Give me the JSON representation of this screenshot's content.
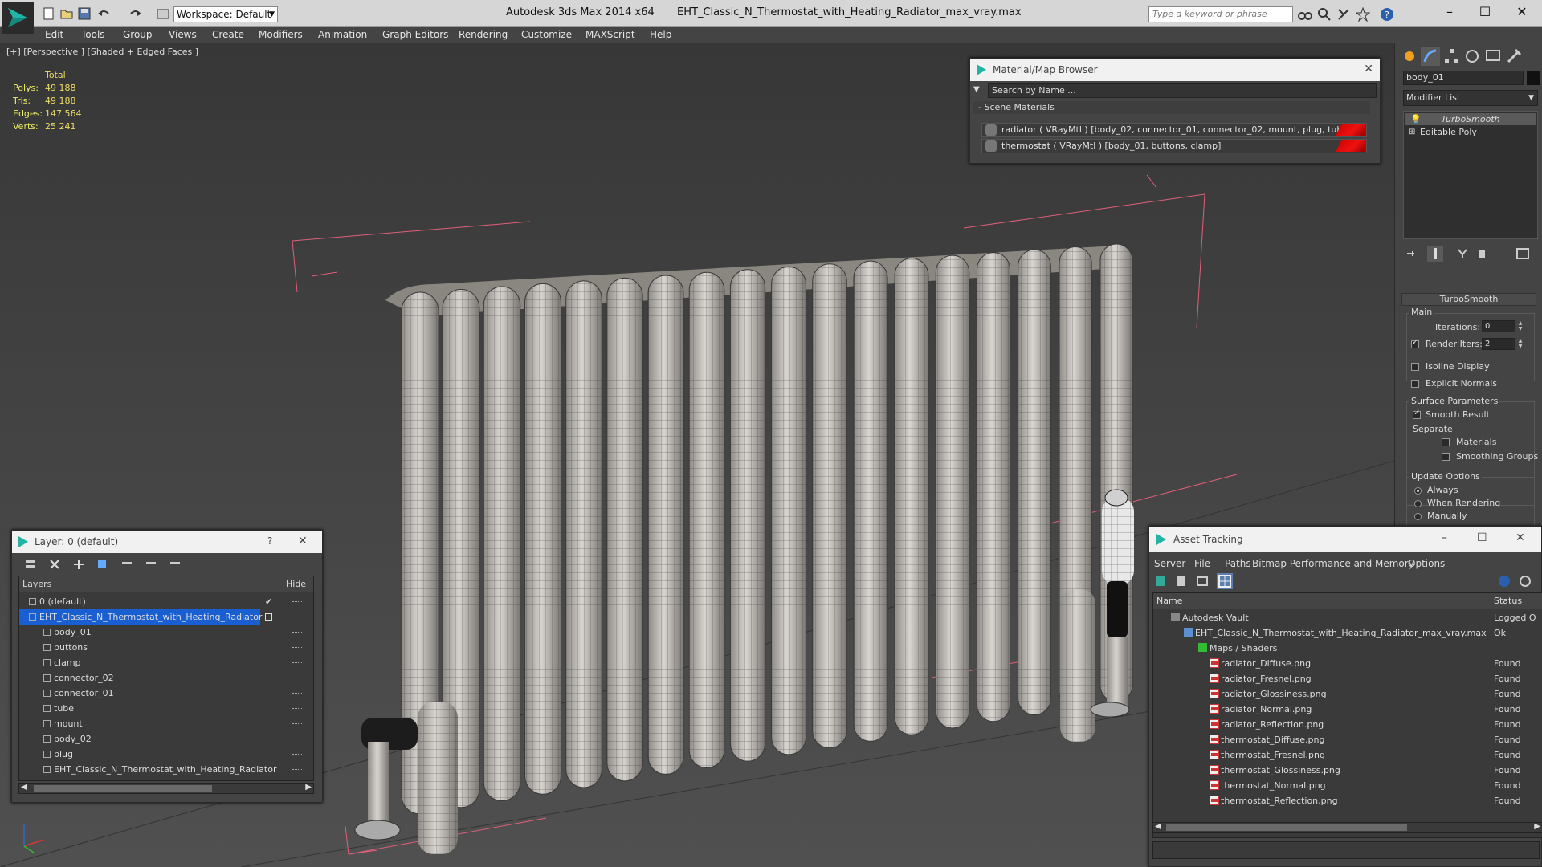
{
  "title_bar": {
    "app_title": "Autodesk 3ds Max  2014 x64",
    "file_name": "EHT_Classic_N_Thermostat_with_Heating_Radiator_max_vray.max",
    "workspace_label": "Workspace: Default",
    "search_placeholder": "Type a keyword or phrase"
  },
  "menu": [
    "Edit",
    "Tools",
    "Group",
    "Views",
    "Create",
    "Modifiers",
    "Animation",
    "Graph Editors",
    "Rendering",
    "Customize",
    "MAXScript",
    "Help"
  ],
  "viewport": {
    "label": "[+] [Perspective ] [Shaded + Edged Faces ]",
    "stats": {
      "header": "Total",
      "rows": [
        {
          "label": "Polys:",
          "value": "49 188"
        },
        {
          "label": "Tris:",
          "value": "49 188"
        },
        {
          "label": "Edges:",
          "value": "147 564"
        },
        {
          "label": "Verts:",
          "value": "25 241"
        }
      ]
    }
  },
  "material_browser": {
    "title": "Material/Map Browser",
    "search_placeholder": "Search by Name ...",
    "section": "- Scene Materials",
    "materials": [
      "radiator  ( VRayMtl ) [body_02, connector_01, connector_02, mount, plug, tube]",
      "thermostat  ( VRayMtl ) [body_01, buttons, clamp]"
    ]
  },
  "command_panel": {
    "object_name": "body_01",
    "modifier_list": "Modifier List",
    "stack": [
      "TurboSmooth",
      "Editable Poly"
    ],
    "rollout_title": "TurboSmooth",
    "main_label": "Main",
    "iterations_label": "Iterations:",
    "iterations_value": "0",
    "render_iters_label": "Render Iters:",
    "render_iters_value": "2",
    "isoline_label": "Isoline Display",
    "explicit_normals_label": "Explicit Normals",
    "surface_params_label": "Surface Parameters",
    "smooth_result_label": "Smooth Result",
    "separate_label": "Separate",
    "materials_label": "Materials",
    "smoothing_groups_label": "Smoothing Groups",
    "update_options_label": "Update Options",
    "always_label": "Always",
    "when_rendering_label": "When Rendering",
    "manually_label": "Manually"
  },
  "layer_panel": {
    "title": "Layer: 0 (default)",
    "help": "?",
    "col_layers": "Layers",
    "col_hide": "Hide",
    "layers": [
      {
        "name": "0 (default)",
        "level": 0
      },
      {
        "name": "EHT_Classic_N_Thermostat_with_Heating_Radiator",
        "level": 0
      },
      {
        "name": "body_01",
        "level": 1
      },
      {
        "name": "buttons",
        "level": 1
      },
      {
        "name": "clamp",
        "level": 1
      },
      {
        "name": "connector_02",
        "level": 1
      },
      {
        "name": "connector_01",
        "level": 1
      },
      {
        "name": "tube",
        "level": 1
      },
      {
        "name": "mount",
        "level": 1
      },
      {
        "name": "body_02",
        "level": 1
      },
      {
        "name": "plug",
        "level": 1
      },
      {
        "name": "EHT_Classic_N_Thermostat_with_Heating_Radiator",
        "level": 1
      }
    ]
  },
  "asset_tracking": {
    "title": "Asset Tracking",
    "menu": [
      "Server",
      "File",
      "Paths",
      "Bitmap Performance and Memory",
      "Options"
    ],
    "col_name": "Name",
    "col_status": "Status",
    "rows": [
      {
        "name": "Autodesk Vault",
        "status": "Logged O"
      },
      {
        "name": "EHT_Classic_N_Thermostat_with_Heating_Radiator_max_vray.max",
        "status": "Ok"
      },
      {
        "name": "Maps / Shaders",
        "status": ""
      },
      {
        "name": "radiator_Diffuse.png",
        "status": "Found"
      },
      {
        "name": "radiator_Fresnel.png",
        "status": "Found"
      },
      {
        "name": "radiator_Glossiness.png",
        "status": "Found"
      },
      {
        "name": "radiator_Normal.png",
        "status": "Found"
      },
      {
        "name": "radiator_Reflection.png",
        "status": "Found"
      },
      {
        "name": "thermostat_Diffuse.png",
        "status": "Found"
      },
      {
        "name": "thermostat_Fresnel.png",
        "status": "Found"
      },
      {
        "name": "thermostat_Glossiness.png",
        "status": "Found"
      },
      {
        "name": "thermostat_Normal.png",
        "status": "Found"
      },
      {
        "name": "thermostat_Reflection.png",
        "status": "Found"
      }
    ]
  },
  "colors": {
    "selection_blue": "#1a5fd1",
    "stat_yellow": "#eeee66",
    "bbox_pink": "#e0607a",
    "material_red": "#dd1111"
  }
}
